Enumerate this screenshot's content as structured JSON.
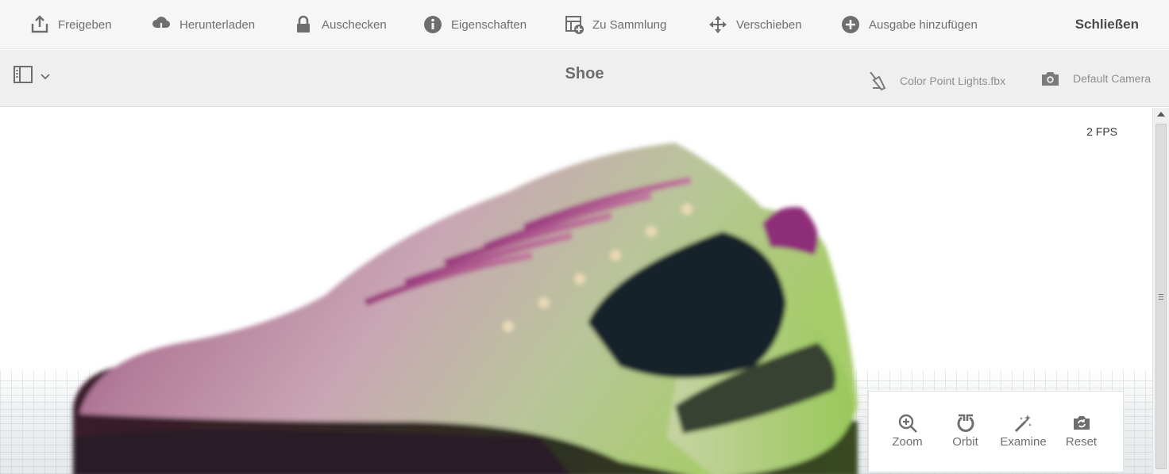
{
  "actionbar": {
    "items": [
      {
        "label": "Freigeben",
        "icon": "share-icon"
      },
      {
        "label": "Herunterladen",
        "icon": "cloud-download-icon"
      },
      {
        "label": "Auschecken",
        "icon": "lock-icon"
      },
      {
        "label": "Eigenschaften",
        "icon": "info-icon"
      },
      {
        "label": "Zu Sammlung",
        "icon": "add-to-collection-icon"
      },
      {
        "label": "Verschieben",
        "icon": "move-icon"
      },
      {
        "label": "Ausgabe hinzufügen",
        "icon": "add-circle-icon"
      }
    ],
    "close_label": "Schließen"
  },
  "titlebar": {
    "title": "Shoe",
    "lights_label": "Color Point Lights.fbx",
    "camera_label": "Default Camera"
  },
  "viewer": {
    "fps": "2 FPS"
  },
  "controls": {
    "items": [
      {
        "label": "Zoom",
        "icon": "zoom-in-icon"
      },
      {
        "label": "Orbit",
        "icon": "orbit-icon"
      },
      {
        "label": "Examine",
        "icon": "examine-icon"
      },
      {
        "label": "Reset",
        "icon": "reset-camera-icon"
      }
    ]
  },
  "colors": {
    "toolbar_bg": "#f6f6f6",
    "titlebar_bg": "#efefef",
    "text": "#6e6e6e"
  }
}
